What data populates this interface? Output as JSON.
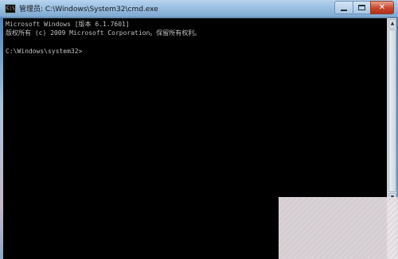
{
  "window": {
    "title": "管理员: C:\\Windows\\System32\\cmd.exe",
    "controls": {
      "minimize": "",
      "maximize": "",
      "close": "✕"
    }
  },
  "console": {
    "lines": [
      "Microsoft Windows [版本 6.1.7601]",
      "版权所有 (c) 2009 Microsoft Corporation。保留所有权利。",
      "C:\\Windows\\system32>"
    ]
  },
  "scrollbar": {
    "up_arrow": "▲",
    "down_arrow": "▼"
  },
  "colors": {
    "console_bg": "#000000",
    "console_text": "#c0c0c0",
    "close_button": "#c7452b"
  }
}
